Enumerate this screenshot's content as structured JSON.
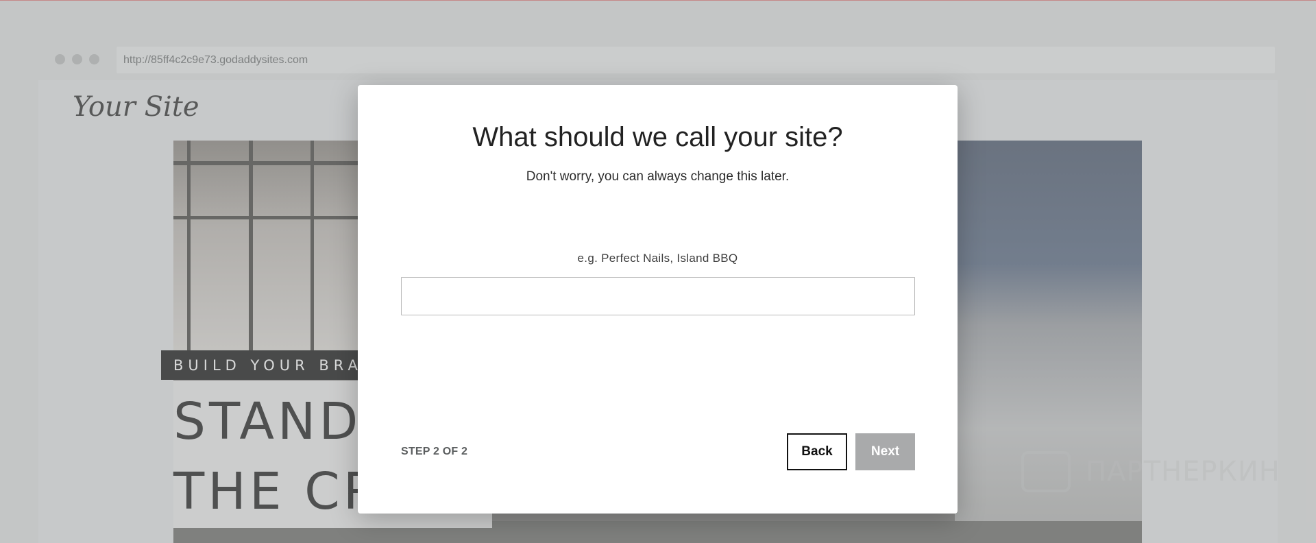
{
  "browser": {
    "url": "http://85ff4c2c9e73.godaddysites.com"
  },
  "site": {
    "logo": "Your Site",
    "tagline": "BUILD YOUR BRAN",
    "headline_line1": "STAND",
    "headline_line2": "THE CR"
  },
  "watermark": {
    "text": "ПАРТНЕРКИН"
  },
  "modal": {
    "title": "What should we call your site?",
    "subtitle": "Don't worry, you can always change this later.",
    "field_label": "e.g. Perfect Nails, Island BBQ",
    "input_value": "",
    "step": "STEP 2 OF 2",
    "back_label": "Back",
    "next_label": "Next"
  },
  "colors": {
    "next_disabled": "#a9aaab",
    "back_border": "#111111",
    "modal_bg": "#ffffff"
  }
}
